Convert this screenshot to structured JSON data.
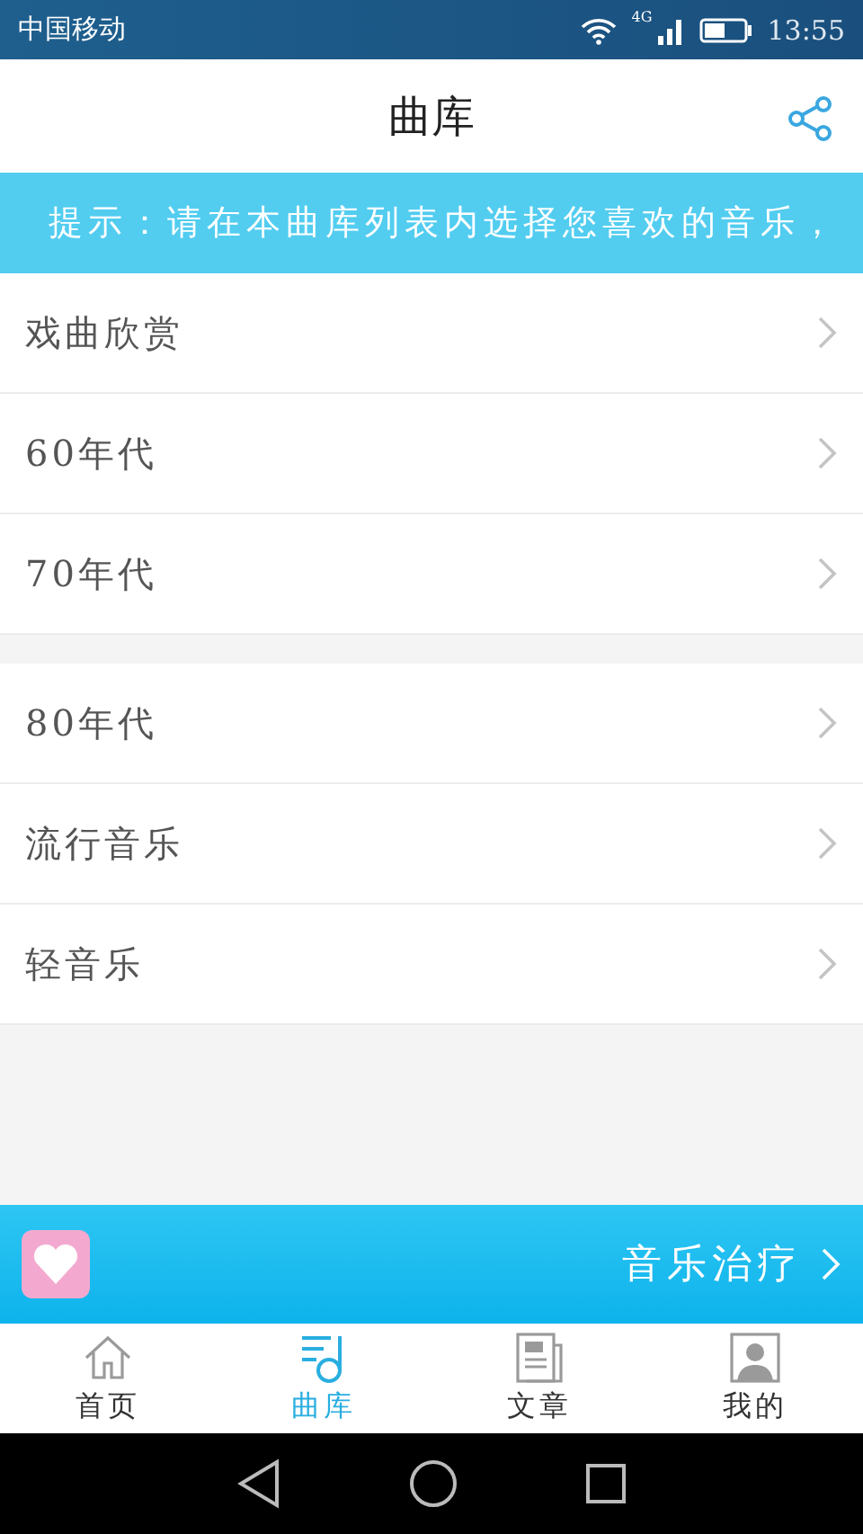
{
  "status_bar": {
    "carrier": "中国移动",
    "network": "4G",
    "time": "13:55"
  },
  "header": {
    "title": "曲库"
  },
  "notice": "提示：请在本曲库列表内选择您喜欢的音乐，",
  "groups": [
    {
      "items": [
        {
          "label": "戏曲欣赏"
        },
        {
          "label": "60年代"
        },
        {
          "label": "70年代"
        }
      ]
    },
    {
      "items": [
        {
          "label": "80年代"
        },
        {
          "label": "流行音乐"
        },
        {
          "label": "轻音乐"
        }
      ]
    }
  ],
  "banner": {
    "label": "音乐治疗"
  },
  "tabs": [
    {
      "label": "首页",
      "kind": "home",
      "selected": false
    },
    {
      "label": "曲库",
      "kind": "library",
      "selected": true
    },
    {
      "label": "文章",
      "kind": "article",
      "selected": false
    },
    {
      "label": "我的",
      "kind": "profile",
      "selected": false
    }
  ]
}
